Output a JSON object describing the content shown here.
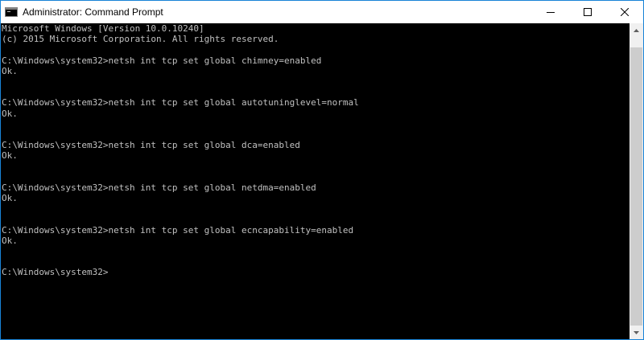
{
  "window": {
    "title": "Administrator: Command Prompt"
  },
  "titlebar": {
    "icons": {
      "app": "cmd-icon",
      "minimize": "minimize-icon",
      "maximize": "maximize-icon",
      "close": "close-icon"
    }
  },
  "console": {
    "lines": [
      "Microsoft Windows [Version 10.0.10240]",
      "(c) 2015 Microsoft Corporation. All rights reserved.",
      "",
      "C:\\Windows\\system32>netsh int tcp set global chimney=enabled",
      "Ok.",
      "",
      "",
      "C:\\Windows\\system32>netsh int tcp set global autotuninglevel=normal",
      "Ok.",
      "",
      "",
      "C:\\Windows\\system32>netsh int tcp set global dca=enabled",
      "Ok.",
      "",
      "",
      "C:\\Windows\\system32>netsh int tcp set global netdma=enabled",
      "Ok.",
      "",
      "",
      "C:\\Windows\\system32>netsh int tcp set global ecncapability=enabled",
      "Ok.",
      "",
      "",
      "C:\\Windows\\system32>"
    ]
  },
  "scrollbar": {
    "icons": {
      "up": "scroll-up-arrow-icon",
      "down": "scroll-down-arrow-icon"
    },
    "position": 1.0
  },
  "colors": {
    "border": "#1883d7",
    "console_bg": "#000000",
    "console_text": "#c0c0c0",
    "titlebar_bg": "#ffffff"
  }
}
